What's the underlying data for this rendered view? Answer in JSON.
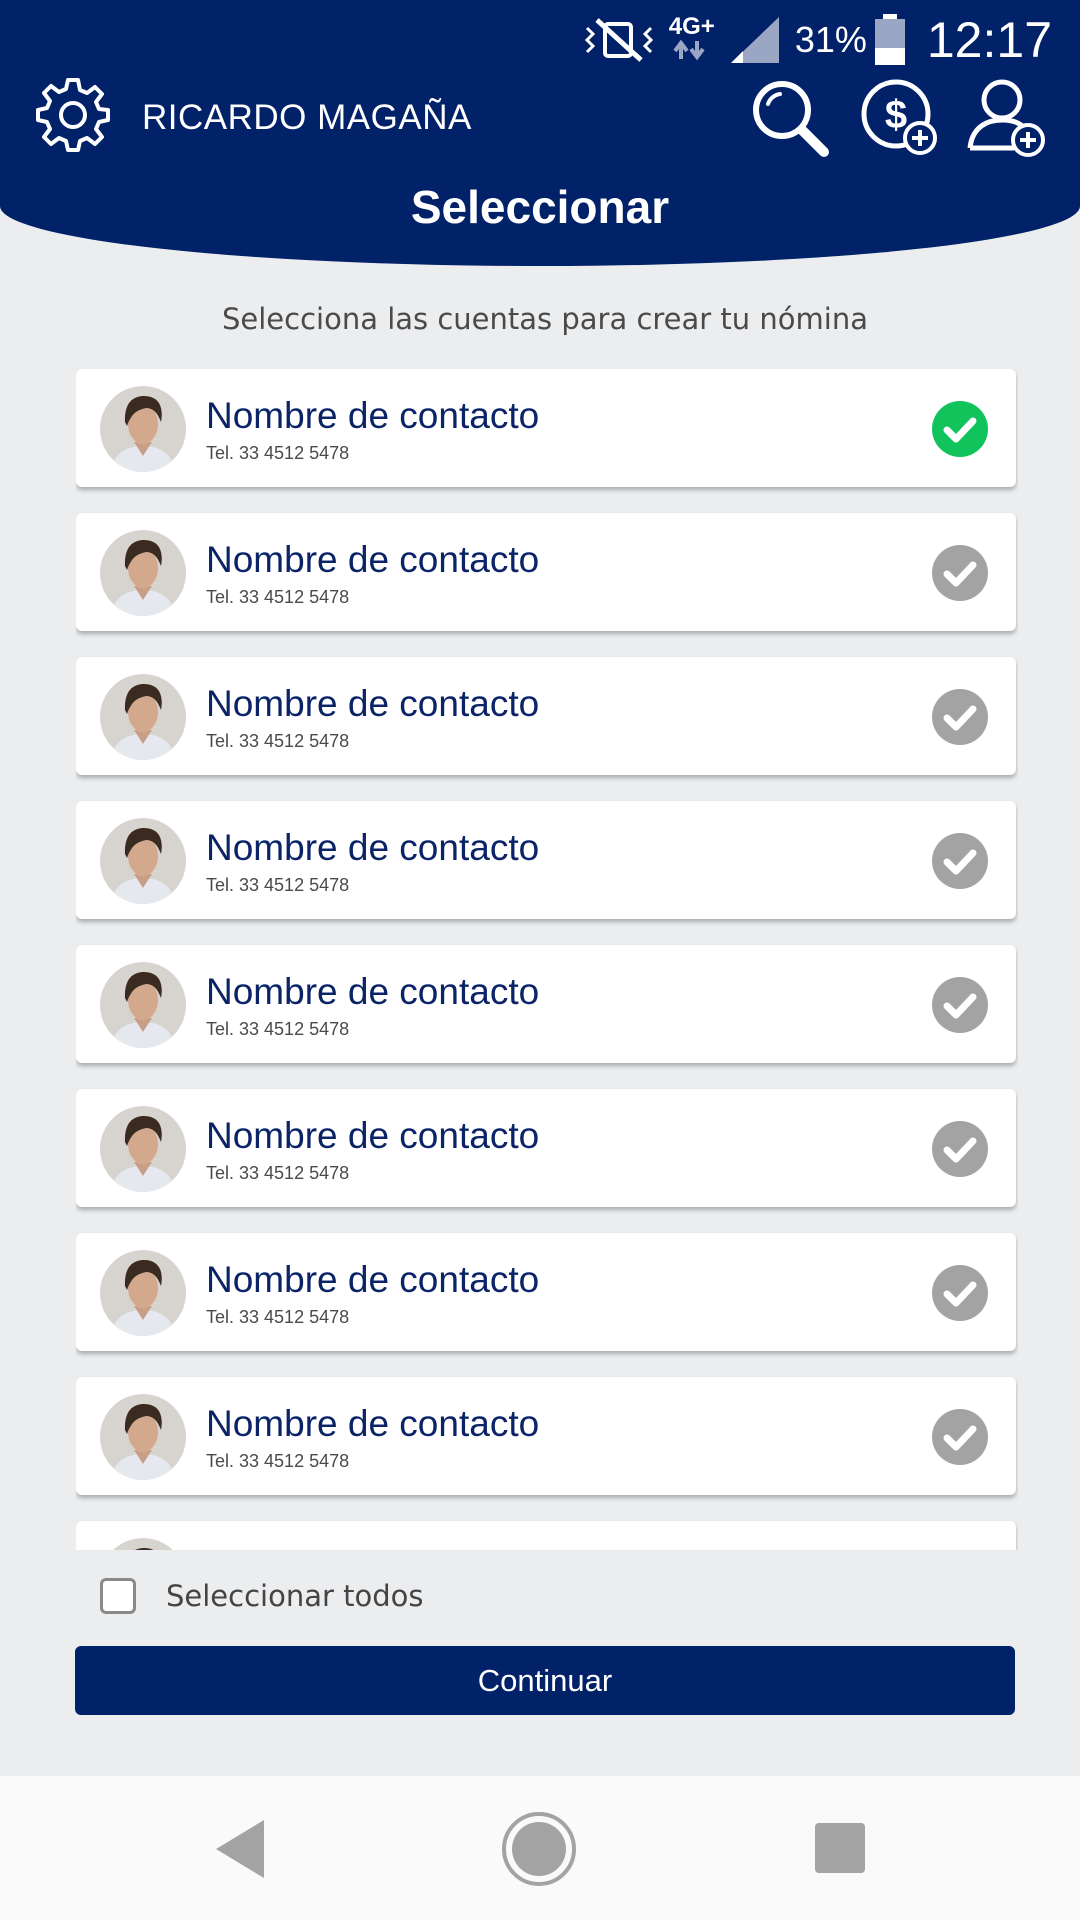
{
  "status_bar": {
    "network": "4G+",
    "battery_percent": "31%",
    "time": "12:17"
  },
  "header": {
    "user_name": "RICARDO MAGAÑA",
    "title": "Seleccionar",
    "icons": [
      "gear-icon",
      "search-icon",
      "add-payment-icon",
      "add-user-icon"
    ]
  },
  "subtitle": "Selecciona las cuentas para crear tu nómina",
  "contacts": [
    {
      "name": "Nombre de contacto",
      "phone": "Tel. 33 4512 5478",
      "selected": true
    },
    {
      "name": "Nombre de contacto",
      "phone": "Tel. 33 4512 5478",
      "selected": false
    },
    {
      "name": "Nombre de contacto",
      "phone": "Tel. 33 4512 5478",
      "selected": false
    },
    {
      "name": "Nombre de contacto",
      "phone": "Tel. 33 4512 5478",
      "selected": false
    },
    {
      "name": "Nombre de contacto",
      "phone": "Tel. 33 4512 5478",
      "selected": false
    },
    {
      "name": "Nombre de contacto",
      "phone": "Tel. 33 4512 5478",
      "selected": false
    },
    {
      "name": "Nombre de contacto",
      "phone": "Tel. 33 4512 5478",
      "selected": false
    },
    {
      "name": "Nombre de contacto",
      "phone": "Tel. 33 4512 5478",
      "selected": false
    },
    {
      "name": "",
      "phone": "",
      "selected": false
    }
  ],
  "select_all": {
    "label": "Seleccionar todos",
    "checked": false
  },
  "continue_button": "Continuar",
  "colors": {
    "primary": "#012168",
    "selected_check": "#10c35a",
    "unselected_check": "#a3a3a3",
    "background": "#ecedef"
  }
}
